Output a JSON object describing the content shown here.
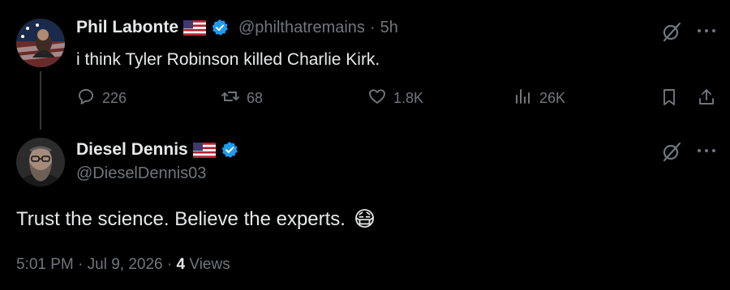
{
  "reply_parent": {
    "display_name": "Phil Labonte",
    "handle": "@philthatremains",
    "separator": "·",
    "time": "5h",
    "text": "i think Tyler Robinson killed Charlie Kirk.",
    "actions": {
      "replies": "226",
      "reposts": "68",
      "likes": "1.8K",
      "views": "26K"
    }
  },
  "main_post": {
    "display_name": "Diesel Dennis",
    "handle": "@DieselDennis03",
    "text": "Trust the science. Believe the experts.",
    "emoji": "😷",
    "time": "5:01 PM",
    "separator": "·",
    "date": "Jul 9, 2026",
    "views_count": "4",
    "views_label": "Views"
  },
  "colors": {
    "background": "#000000",
    "text_primary": "#e7e9ea",
    "text_secondary": "#71767b",
    "verified": "#1d9bf0",
    "thread_line": "#333639"
  },
  "icons": [
    "flag-us-icon",
    "verified-badge-icon",
    "grok-icon",
    "more-icon",
    "reply-icon",
    "repost-icon",
    "like-icon",
    "views-icon",
    "bookmark-icon",
    "share-icon"
  ]
}
